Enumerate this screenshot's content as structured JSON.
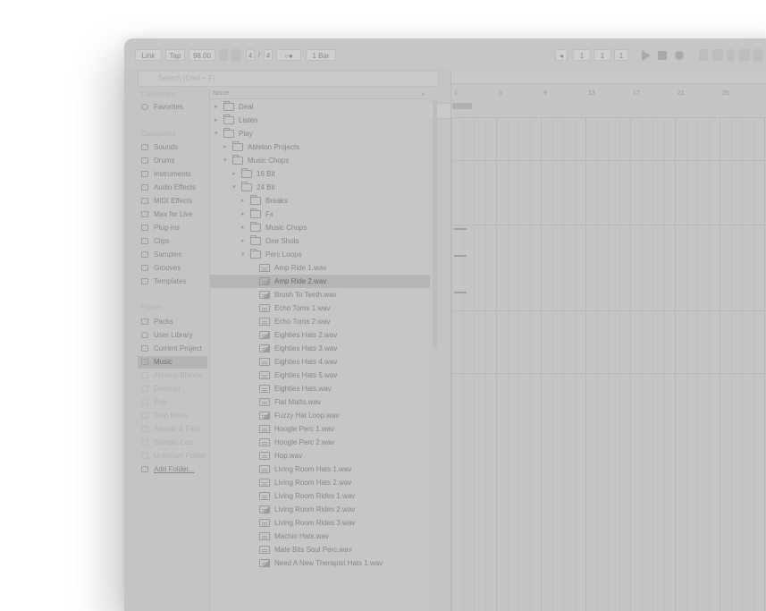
{
  "toolbar": {
    "link": "Link",
    "tap": "Tap",
    "tempo": "98.00",
    "sig_num": "4",
    "sig_sep": "/",
    "sig_den": "4",
    "metronome": "○●",
    "quantize": "1 Bar",
    "position": [
      "1",
      "1",
      "1"
    ],
    "loop_btn": "◂"
  },
  "search": {
    "placeholder": "Search (Cmd + F)"
  },
  "sidebar": {
    "collections_header": "Collections",
    "favorites": "Favorites",
    "categories_header": "Categories",
    "categories": [
      "Sounds",
      "Drums",
      "Instruments",
      "Audio Effects",
      "MIDI Effects",
      "Max for Live",
      "Plug-ins",
      "Clips",
      "Samples",
      "Grooves",
      "Templates"
    ],
    "places_header": "Places",
    "places": [
      "Packs",
      "User Library",
      "Current Project",
      "Music",
      "Ableton Blends",
      "Desktop",
      "Pub",
      "Trap Beats",
      "Alessio & Fabi",
      "Sample Cue",
      "Unknown Folder"
    ],
    "add_folder": "Add Folder..."
  },
  "tree": {
    "header": "Name",
    "rows": [
      {
        "label": "Deal",
        "level": 0,
        "type": "folder",
        "chevron": "▸"
      },
      {
        "label": "Listen",
        "level": 0,
        "type": "folder",
        "chevron": "▸"
      },
      {
        "label": "Play",
        "level": 0,
        "type": "folder",
        "chevron": "▾"
      },
      {
        "label": "Ableton Projects",
        "level": 1,
        "type": "folder",
        "chevron": "▸"
      },
      {
        "label": "Music Chops",
        "level": 1,
        "type": "folder",
        "chevron": "▾"
      },
      {
        "label": "16 Bit",
        "level": 2,
        "type": "folder",
        "chevron": "▸"
      },
      {
        "label": "24 Bit",
        "level": 2,
        "type": "folder",
        "chevron": "▾"
      },
      {
        "label": "Breaks",
        "level": 3,
        "type": "folder",
        "chevron": "▸"
      },
      {
        "label": "Fx",
        "level": 3,
        "type": "folder",
        "chevron": "▸"
      },
      {
        "label": "Music Chops",
        "level": 3,
        "type": "folder",
        "chevron": "▸"
      },
      {
        "label": "One Shots",
        "level": 3,
        "type": "folder",
        "chevron": "▸"
      },
      {
        "label": "Perc Loops",
        "level": 3,
        "type": "folder",
        "chevron": "▾"
      },
      {
        "label": "Amp Ride 1.wav",
        "level": 4,
        "type": "file"
      },
      {
        "label": "Amp Ride 2.wav",
        "level": 4,
        "type": "file-b",
        "selected": true
      },
      {
        "label": "Brush To Teeth.wav",
        "level": 4,
        "type": "file-b"
      },
      {
        "label": "Echo Toms 1.wav",
        "level": 4,
        "type": "file"
      },
      {
        "label": "Echo Toms 2.wav",
        "level": 4,
        "type": "file"
      },
      {
        "label": "Eighties Hats 2.wav",
        "level": 4,
        "type": "file-b"
      },
      {
        "label": "Eighties Hats 3.wav",
        "level": 4,
        "type": "file-b"
      },
      {
        "label": "Eighties Hats 4.wav",
        "level": 4,
        "type": "file"
      },
      {
        "label": "Eighties Hats 5.wav",
        "level": 4,
        "type": "file"
      },
      {
        "label": "Eighties Hats.wav",
        "level": 4,
        "type": "file"
      },
      {
        "label": "Flat Matto.wav",
        "level": 4,
        "type": "file"
      },
      {
        "label": "Fuzzy Hat Loop.wav",
        "level": 4,
        "type": "file-b"
      },
      {
        "label": "Hoogle Perc 1.wav",
        "level": 4,
        "type": "file"
      },
      {
        "label": "Hoogle Perc 2.wav",
        "level": 4,
        "type": "file"
      },
      {
        "label": "Hop.wav",
        "level": 4,
        "type": "file"
      },
      {
        "label": "Living Room Hats 1.wav",
        "level": 4,
        "type": "file"
      },
      {
        "label": "Living Room Hats 2.wav",
        "level": 4,
        "type": "file"
      },
      {
        "label": "Living Room Rides 1.wav",
        "level": 4,
        "type": "file"
      },
      {
        "label": "Living Room Rides 2.wav",
        "level": 4,
        "type": "file-b"
      },
      {
        "label": "Living Room Rides 3.wav",
        "level": 4,
        "type": "file"
      },
      {
        "label": "Machin Hats.wav",
        "level": 4,
        "type": "file"
      },
      {
        "label": "Mate Bits Soul Perc.wav",
        "level": 4,
        "type": "file"
      },
      {
        "label": "Need A New Therapist Hats 1.wav",
        "level": 4,
        "type": "file-b"
      }
    ]
  },
  "arrangement": {
    "ruler": [
      "1",
      "5",
      "9",
      "13",
      "17",
      "21",
      "25"
    ]
  }
}
